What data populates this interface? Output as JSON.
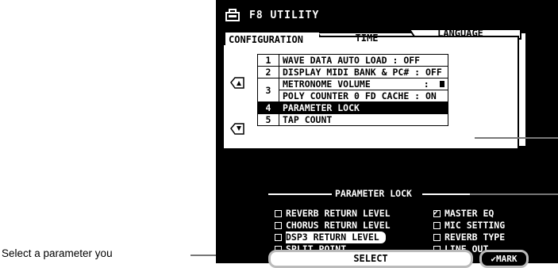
{
  "title": "F8 UTILITY",
  "tabs": [
    "CONFIGURATION",
    "TIME",
    "LANGUAGE"
  ],
  "rows": [
    {
      "num": "1",
      "cells": [
        "WAVE DATA AUTO LOAD : OFF"
      ]
    },
    {
      "num": "2",
      "cells": [
        "DISPLAY MIDI BANK & PC#   : OFF"
      ]
    },
    {
      "num": "3",
      "cells": [
        "METRONOME VOLUME",
        "POLY COUNTER    0  FD CACHE : ON"
      ],
      "metronome_value": ":"
    },
    {
      "num": "4",
      "cells": [
        "PARAMETER LOCK"
      ],
      "selected": true
    },
    {
      "num": "5",
      "cells": [
        "TAP COUNT"
      ]
    }
  ],
  "section_title": "PARAMETER LOCK",
  "options": [
    {
      "label": "REVERB RETURN LEVEL",
      "checked": false
    },
    {
      "label": "MASTER EQ",
      "checked": true
    },
    {
      "label": "CHORUS RETURN LEVEL",
      "checked": false
    },
    {
      "label": "MIC SETTING",
      "checked": false
    },
    {
      "label": "DSP3 RETURN LEVEL",
      "checked": false,
      "highlighted": true
    },
    {
      "label": "REVERB TYPE",
      "checked": false
    },
    {
      "label": "SPLIT POINT",
      "checked": false
    },
    {
      "label": "LINE OUT",
      "checked": false
    }
  ],
  "buttons": {
    "select": "SELECT",
    "mark": "✔MARK"
  },
  "callout": "Select a parameter you"
}
